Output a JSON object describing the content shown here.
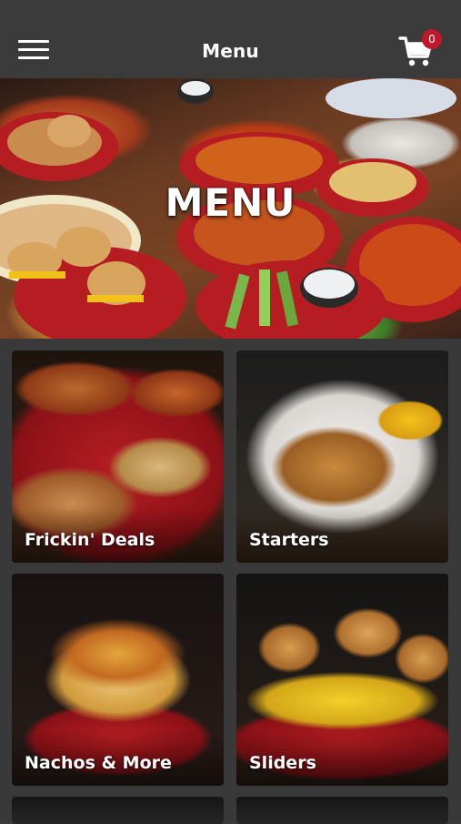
{
  "header": {
    "title": "Menu",
    "cart_count": "0",
    "icons": {
      "menu": "hamburger-icon",
      "cart": "cart-icon"
    }
  },
  "hero": {
    "title": "MENU"
  },
  "categories": [
    {
      "label": "Frickin' Deals"
    },
    {
      "label": "Starters"
    },
    {
      "label": "Nachos & More"
    },
    {
      "label": "Sliders"
    }
  ],
  "colors": {
    "topbar": "#3b3b3b",
    "background": "#393939",
    "badge": "#c0182b",
    "plate_red": "#b51d22"
  }
}
